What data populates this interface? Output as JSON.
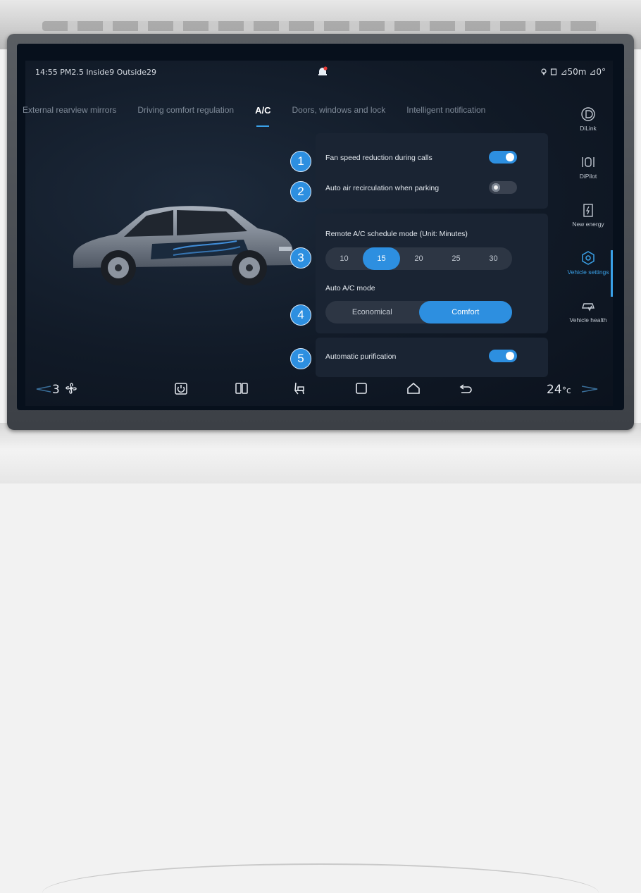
{
  "status": {
    "time": "14:55",
    "air": "PM2.5 Inside9 Outside29",
    "right": "⊿50m ⊿0°"
  },
  "tabs": [
    {
      "label": "External rearview mirrors"
    },
    {
      "label": "Driving comfort regulation"
    },
    {
      "label": "A/C"
    },
    {
      "label": "Doors, windows and lock"
    },
    {
      "label": "Intelligent notification"
    }
  ],
  "badges": [
    "1",
    "2",
    "3",
    "4",
    "5"
  ],
  "settings": {
    "fan_speed_label": "Fan speed reduction during calls",
    "fan_speed_on": true,
    "recirc_label": "Auto air recirculation when parking",
    "recirc_on": false,
    "schedule_label": "Remote A/C schedule mode  (Unit: Minutes)",
    "schedule_options": [
      "10",
      "15",
      "20",
      "25",
      "30"
    ],
    "schedule_selected": "15",
    "auto_mode_label": "Auto A/C mode",
    "auto_mode_options": [
      "Economical",
      "Comfort"
    ],
    "auto_mode_selected": "Comfort",
    "purification_label": "Automatic purification",
    "purification_on": true
  },
  "sidebar": [
    {
      "label": "DiLink",
      "icon": "dilink-icon"
    },
    {
      "label": "DiPilot",
      "icon": "dipilot-icon"
    },
    {
      "label": "New energy",
      "icon": "battery-icon"
    },
    {
      "label": "Vehicle settings",
      "icon": "gear-icon"
    },
    {
      "label": "Vehicle health",
      "icon": "car-health-icon"
    }
  ],
  "dock": {
    "fan_level": "3",
    "temperature": "24",
    "temperature_unit": "°c"
  },
  "colors": {
    "accent": "#2d8fe0",
    "background": "#111a27",
    "panel": "#1a2433"
  }
}
